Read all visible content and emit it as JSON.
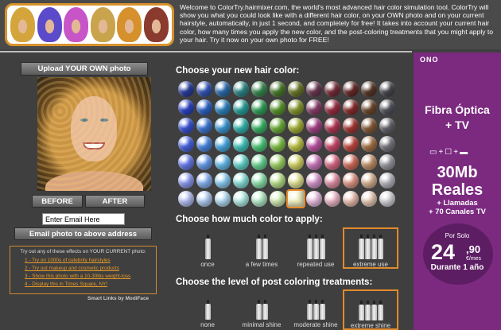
{
  "header": {
    "intro": "Welcome to ColorTry.hairmixer.com, the world's most advanced hair color simulation tool. ColorTry will show you what you could look like with a different hair color, on your OWN photo and on your current hairstyle, automatically, in just 1 second, and completely for free! It takes into account your current hair color, how many times you apply the new color, and the post-coloring treatments that you might apply to your hair. Try it now on your own photo for FREE!",
    "thumb_colors": [
      "#d4a53a",
      "#5b4ac9",
      "#c855c8",
      "#c9a44c",
      "#d6902c",
      "#8a3b2d"
    ]
  },
  "left": {
    "upload_label": "Upload YOUR OWN photo",
    "before_label": "BEFORE",
    "after_label": "AFTER",
    "email_placeholder": "Enter Email Here",
    "email_value": "Enter Email Here",
    "email_button_label": "Email photo to above address",
    "try_title": "Try out any of these effects on YOUR CURRENT photo:",
    "try_links": [
      "1 - Try on 1000s of celebrity hairstyles",
      "2 - Try out makeup and cosmetic products",
      "3 - Show this photo with a 10-30lbs weight-loss",
      "4 - Display this in Times Square, NY!"
    ],
    "smart_links": "Smart Links by ModiFace"
  },
  "colors": {
    "title": "Choose your new hair color:",
    "selected_index": 78,
    "rows": [
      [
        "#2b3fa0",
        "#3557b8",
        "#2f6fb0",
        "#2f8a8a",
        "#3a8d52",
        "#4d7f2e",
        "#6e7a2a",
        "#6e3a55",
        "#7a2f3a",
        "#6b2b2b",
        "#5a3a2a",
        "#4a4a52"
      ],
      [
        "#2d45c9",
        "#2f66c9",
        "#2f87c2",
        "#2aa39e",
        "#34a55c",
        "#5c9a2d",
        "#8a9a2e",
        "#8c3f6c",
        "#9c3044",
        "#8a302e",
        "#6e4a30",
        "#555560"
      ],
      [
        "#3a56d8",
        "#3f7ad6",
        "#3f9bd6",
        "#35b8b0",
        "#3cb86a",
        "#6fb23a",
        "#a8b33a",
        "#a8468a",
        "#b63a58",
        "#a83a36",
        "#8a5e3a",
        "#66666e"
      ],
      [
        "#4a66e6",
        "#4b8ae6",
        "#4aace6",
        "#44c8c0",
        "#4fcc7c",
        "#84c64a",
        "#c2c84a",
        "#c058a6",
        "#cc4a6c",
        "#c24a40",
        "#a87448",
        "#7a7a82"
      ],
      [
        "#6a7ef0",
        "#6aa0f0",
        "#68bff0",
        "#66d8d0",
        "#6ad996",
        "#a0d668",
        "#d8d868",
        "#d07ac0",
        "#dc6c88",
        "#d4705e",
        "#c4946c",
        "#9a9aa2"
      ],
      [
        "#8e9ff4",
        "#8ab6f4",
        "#8ccff4",
        "#8ce4dc",
        "#8ee6ae",
        "#bce48c",
        "#e8e89a",
        "#dc9ad0",
        "#e494a8",
        "#e29a88",
        "#d8b494",
        "#b8b8c0"
      ],
      [
        "#b8c2f8",
        "#b4d0f8",
        "#b6e0f8",
        "#b6f0ea",
        "#b8f0cc",
        "#d6f0b4",
        "#f2f2c4",
        "#ecc0e4",
        "#f0bccc",
        "#f0c2b4",
        "#eacdb8",
        "#d6d6dc"
      ]
    ]
  },
  "amount": {
    "title": "Choose how much color to apply:",
    "options": [
      "once",
      "a few times",
      "repeated use",
      "extreme use"
    ],
    "selected": "extreme use"
  },
  "post": {
    "title": "Choose the level of post coloring treatments:",
    "options": [
      "none",
      "minimal shine",
      "moderate shine",
      "extreme shine"
    ],
    "selected": "extreme shine"
  },
  "ad": {
    "logo": "ONO",
    "headline_line1": "Fibra Óptica",
    "headline_line2": "+ TV",
    "speed_line1": "30Mb",
    "speed_line2": "Reales",
    "extra_line1": "+ Llamadas",
    "extra_line2": "+ 70 Canales TV",
    "por_solo": "Por Solo",
    "price": "24",
    "cents": ",90",
    "unit": "€/mes",
    "period": "Durante 1 año",
    "bg_color": "#7b2a80"
  }
}
